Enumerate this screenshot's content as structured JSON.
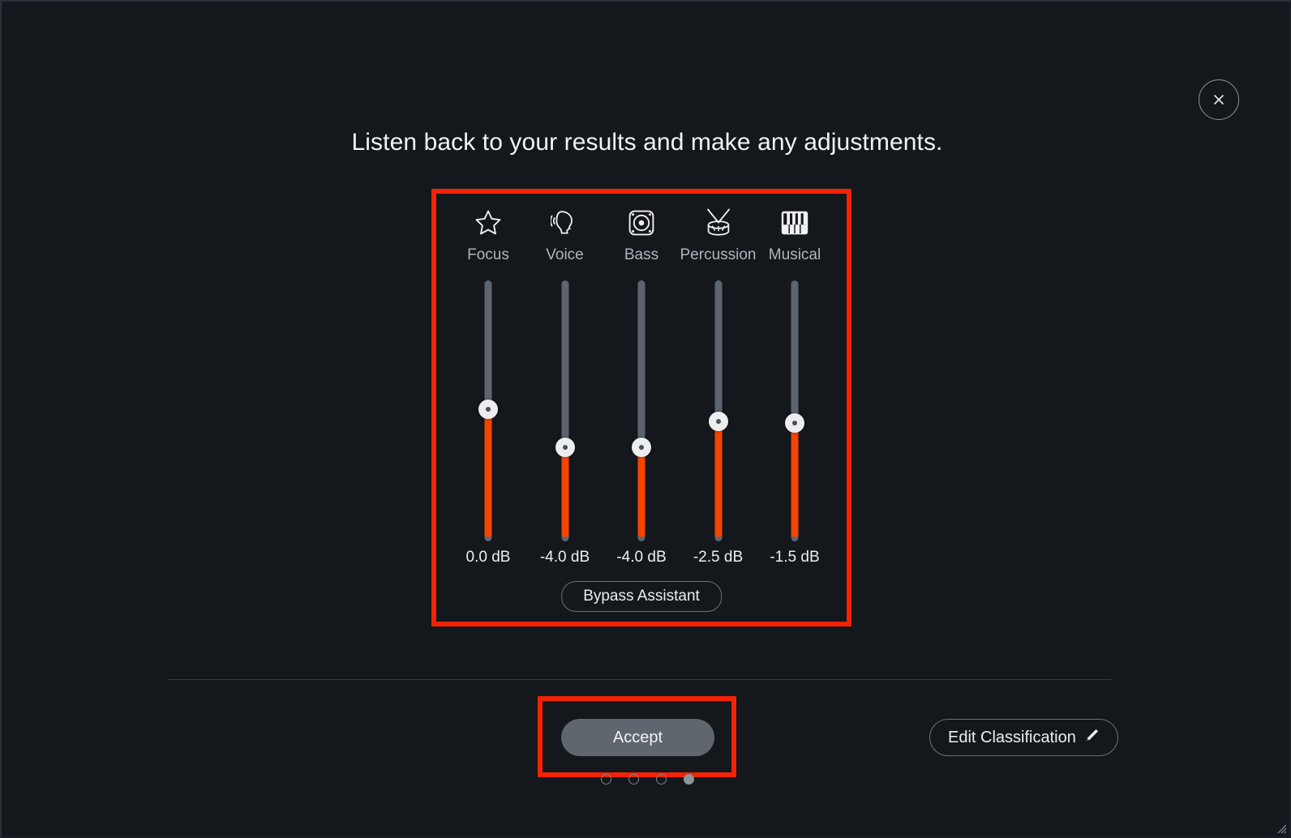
{
  "window": {
    "background_color": "#14171c",
    "accent_color": "#f44400",
    "annotation_color": "#f52205"
  },
  "header": {
    "headline": "Listen back to your results and make any adjustments.",
    "close_icon": "close-icon"
  },
  "mixer": {
    "channels": [
      {
        "icon": "star-icon",
        "label": "Focus",
        "value": "0.0 dB",
        "fill_percent": 50,
        "thumb_percent": 50
      },
      {
        "icon": "voice-icon",
        "label": "Voice",
        "value": "-4.0 dB",
        "fill_percent": 35,
        "thumb_percent": 35
      },
      {
        "icon": "bass-icon",
        "label": "Bass",
        "value": "-4.0 dB",
        "fill_percent": 35,
        "thumb_percent": 35
      },
      {
        "icon": "drum-icon",
        "label": "Percussion",
        "value": "-2.5 dB",
        "fill_percent": 45,
        "thumb_percent": 45
      },
      {
        "icon": "piano-icon",
        "label": "Musical",
        "value": "-1.5 dB",
        "fill_percent": 44.5,
        "thumb_percent": 44.5
      }
    ],
    "bypass_label": "Bypass Assistant"
  },
  "footer": {
    "accept_label": "Accept",
    "edit_classification_label": "Edit Classification",
    "edit_classification_icon": "pencil-icon",
    "pager": {
      "total": 4,
      "active_index": 3
    }
  }
}
